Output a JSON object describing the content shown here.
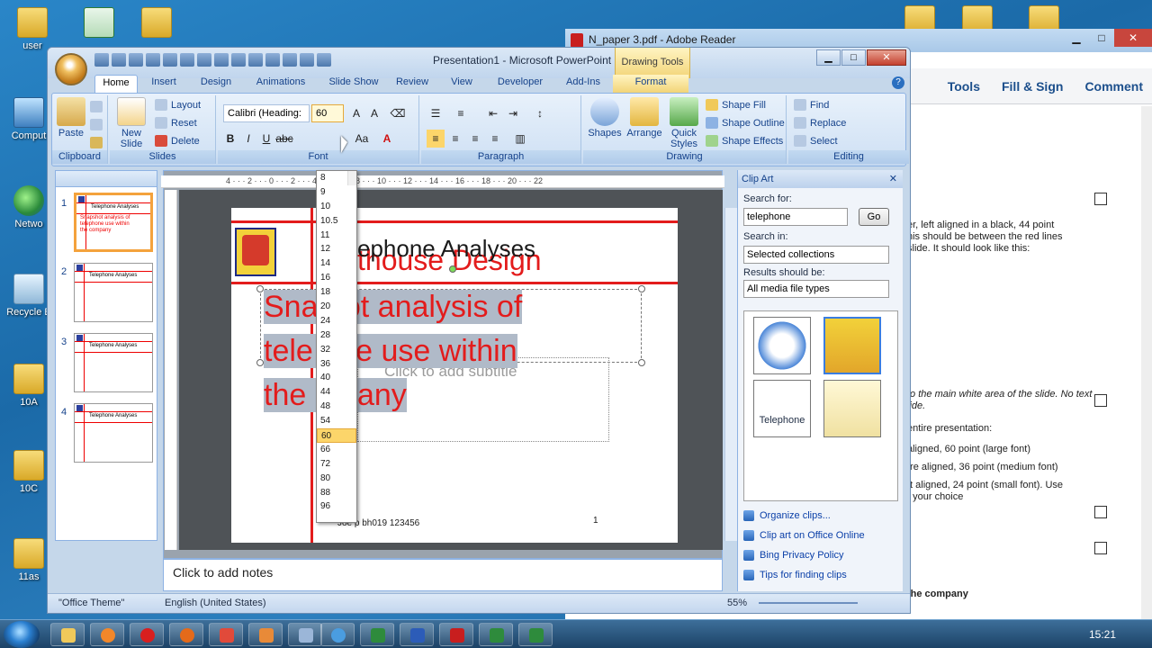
{
  "desktop": {
    "icons": [
      {
        "label": "user"
      },
      {
        "label": "Comput"
      },
      {
        "label": "Netwo"
      },
      {
        "label": "Recycle B"
      },
      {
        "label": "10A"
      },
      {
        "label": "10C"
      },
      {
        "label": "11as"
      }
    ]
  },
  "reader": {
    "title": "N_paper 3.pdf - Adobe Reader",
    "toolbar": [
      "Tools",
      "Fill & Sign",
      "Comment"
    ],
    "lines": [
      "er, left aligned in a black, 44 point",
      "his should be between the red lines",
      "slide. It should look like this:",
      "to the main white area of the slide. No text",
      "lide.",
      "entire presentation:",
      "aligned, 60 point (large font)",
      "tre aligned, 36 point (medium font)",
      "ft aligned, 24 point (small font). Use",
      "f your choice",
      "the company"
    ]
  },
  "ppt": {
    "window_title": "Presentation1 - Microsoft PowerPoint",
    "contextual_tab": "Drawing Tools",
    "tabs": [
      "Home",
      "Insert",
      "Design",
      "Animations",
      "Slide Show",
      "Review",
      "View",
      "Developer",
      "Add-Ins",
      "Format"
    ],
    "ribbon": {
      "clipboard": {
        "paste": "Paste",
        "label": "Clipboard"
      },
      "slides": {
        "new_slide": "New Slide",
        "layout": "Layout",
        "reset": "Reset",
        "delete": "Delete",
        "label": "Slides"
      },
      "font": {
        "name": "Calibri (Heading:",
        "size": "60",
        "label": "Font"
      },
      "paragraph": {
        "label": "Paragraph"
      },
      "drawing": {
        "shapes": "Shapes",
        "arrange": "Arrange",
        "quick_styles": "Quick Styles",
        "fill": "Shape Fill",
        "outline": "Shape Outline",
        "effects": "Shape Effects",
        "label": "Drawing"
      },
      "editing": {
        "find": "Find",
        "replace": "Replace",
        "select": "Select",
        "label": "Editing"
      }
    },
    "font_sizes": [
      "8",
      "9",
      "10",
      "10.5",
      "11",
      "12",
      "14",
      "16",
      "18",
      "20",
      "24",
      "28",
      "32",
      "36",
      "40",
      "44",
      "48",
      "54",
      "60",
      "66",
      "72",
      "80",
      "88",
      "96"
    ],
    "selected_font_size": "60",
    "ruler_numbers": "4 · · · 2 · · · 0 · · · 2 · · · 4 · · · 6 · · · 8 · · · 10 · · · 12 · · · 14 · · · 16 · · · 18 · · · 20 · · · 22",
    "thumbnails": [
      {
        "num": "1",
        "title": "Telephone Analyses",
        "subtitle": "Snapshot analysis of telephone use within the company"
      },
      {
        "num": "2",
        "title": "Telephone Analyses"
      },
      {
        "num": "3",
        "title": "Telephone Analyses"
      },
      {
        "num": "4",
        "title": "Telephone Analyses"
      }
    ],
    "slide": {
      "title": "ephone Analyses",
      "behind_text": "thouse Design",
      "subtitle_lines": [
        "Sna  hot analysis of",
        "tele  one use within",
        "the  mpany"
      ],
      "placeholder": "Click to add subtitle",
      "footer": "Joe p bh019 123456",
      "page_num": "1"
    },
    "notes": "Click to add notes",
    "clipart": {
      "title": "Clip Art",
      "search_label": "Search for:",
      "search_value": "telephone",
      "go": "Go",
      "search_in_label": "Search in:",
      "search_in_value": "Selected collections",
      "results_label": "Results should be:",
      "results_value": "All media file types",
      "clip_label": "Telephone",
      "links": [
        "Organize clips...",
        "Clip art on Office Online",
        "Bing Privacy Policy",
        "Tips for finding clips"
      ]
    },
    "status": {
      "theme": "\"Office Theme\"",
      "language": "English (United States)",
      "zoom": "55%"
    }
  },
  "taskbar": {
    "time": "15:21"
  },
  "colors": {
    "accent_red": "#e31c1c",
    "ribbon_blue": "#15428b"
  }
}
